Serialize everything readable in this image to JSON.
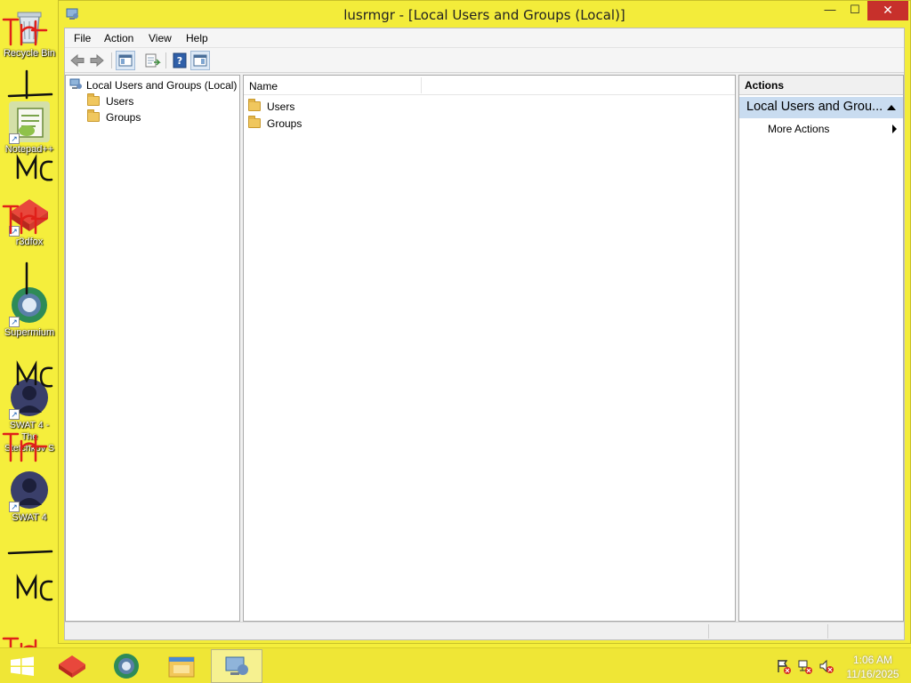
{
  "window": {
    "title": "lusrmgr - [Local Users and Groups (Local)]",
    "min_glyph": "—",
    "max_glyph": "☐",
    "close_glyph": "✕"
  },
  "menubar": {
    "items": [
      {
        "label": "File"
      },
      {
        "label": "Action"
      },
      {
        "label": "View"
      },
      {
        "label": "Help"
      }
    ]
  },
  "toolbar": {
    "buttons": [
      "back-icon",
      "forward-icon",
      "show-hide-console-tree-icon",
      "export-list-icon",
      "help-icon",
      "show-hide-action-pane-icon"
    ]
  },
  "tree": {
    "root_label": "Local Users and Groups (Local)",
    "items": [
      {
        "label": "Users"
      },
      {
        "label": "Groups"
      }
    ]
  },
  "list": {
    "columns": [
      {
        "label": "Name"
      }
    ],
    "rows": [
      {
        "name": "Users"
      },
      {
        "name": "Groups"
      }
    ]
  },
  "actions": {
    "header": "Actions",
    "group_title": "Local Users and Grou...",
    "items": [
      {
        "label": "More Actions"
      }
    ]
  },
  "desktop": {
    "icons": [
      {
        "label": "Recycle Bin"
      },
      {
        "label": "Notepad++"
      },
      {
        "label": "r3dfox"
      },
      {
        "label": "Supermium"
      },
      {
        "label": "SWAT 4 - The Stetchkov S"
      },
      {
        "label": "SWAT 4"
      }
    ]
  },
  "taskbar": {
    "clock_time": "1:06 AM",
    "clock_date": "11/16/2025"
  },
  "colors": {
    "desktop_yellow": "#f5ee3c",
    "close_red": "#c7302b",
    "actions_group_blue": "#c9dcf0",
    "scribble_red": "#e0201a"
  }
}
